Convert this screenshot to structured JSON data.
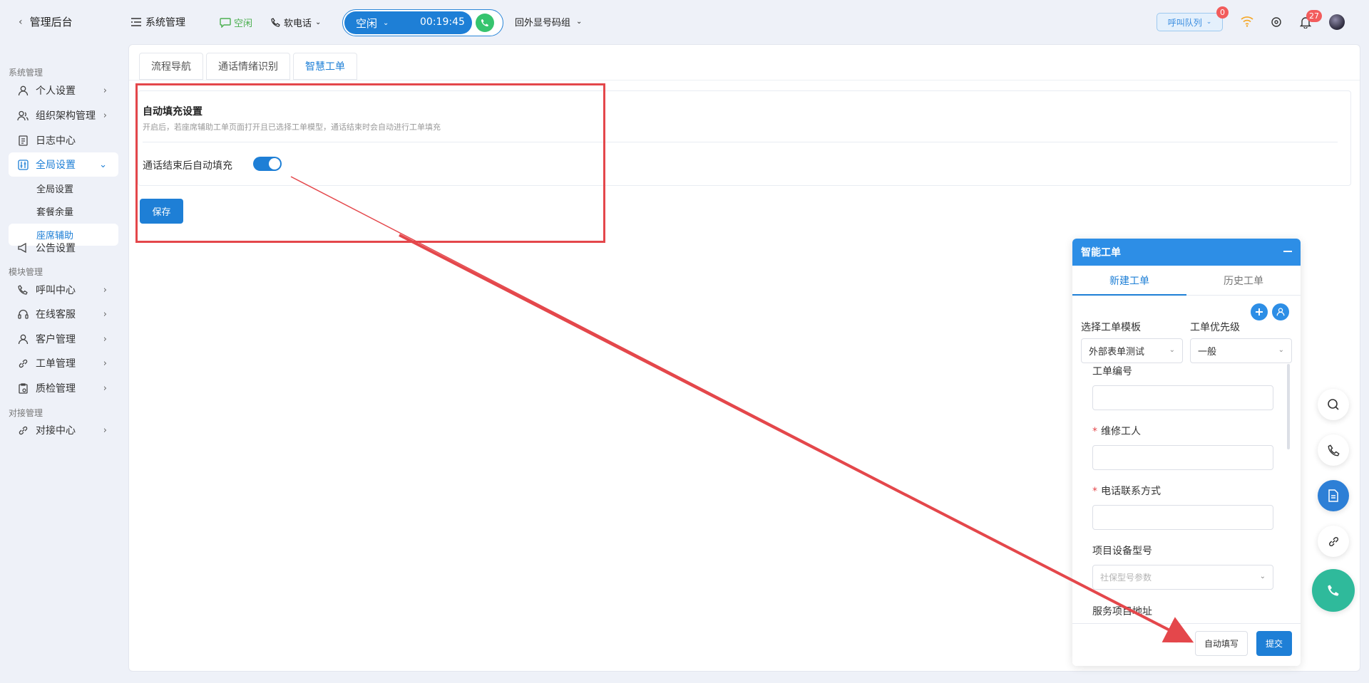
{
  "topbar": {
    "back_label": "管理后台",
    "system_label": "系统管理",
    "agent_status": "空闲",
    "softphone_label": "软电话",
    "call_status": "空闲",
    "call_timer": "00:19:45",
    "outbound_group": "回外显号码组",
    "queue_label": "呼叫队列",
    "queue_badge": "0",
    "notify_badge": "27"
  },
  "sidebar": {
    "sections": {
      "system": "系统管理",
      "module": "模块管理",
      "integration": "对接管理"
    },
    "items": {
      "personal": "个人设置",
      "org": "组织架构管理",
      "log": "日志中心",
      "global": "全局设置",
      "global_sub": "全局设置",
      "package": "套餐余量",
      "seat_assist": "座席辅助",
      "announce": "公告设置",
      "callcenter": "呼叫中心",
      "online": "在线客服",
      "customer": "客户管理",
      "ticket": "工单管理",
      "qc": "质检管理",
      "integration": "对接中心"
    }
  },
  "tabs": [
    "流程导航",
    "通话情绪识别",
    "智慧工单"
  ],
  "settings": {
    "title": "自动填充设置",
    "description": "开启后，若座席辅助工单页面打开且已选择工单模型，通话结束时会自动进行工单填充",
    "switch_label": "通话结束后自动填充",
    "switch_on": true,
    "save_label": "保存"
  },
  "panel": {
    "title": "智能工单",
    "tab_new": "新建工单",
    "tab_history": "历史工单",
    "template_label": "选择工单模板",
    "template_value": "外部表单测试",
    "priority_label": "工单优先级",
    "priority_value": "一般",
    "field_ticket_no": "工单编号",
    "field_worker": "维修工人",
    "field_phone": "电话联系方式",
    "field_device": "项目设备型号",
    "device_placeholder": "社保型号参数",
    "field_address": "服务项目地址",
    "autofill_label": "自动填写",
    "submit_label": "提交"
  },
  "colors": {
    "primary": "#1e7fd6",
    "annotation": "#e4474b",
    "status_green": "#4caf50"
  }
}
